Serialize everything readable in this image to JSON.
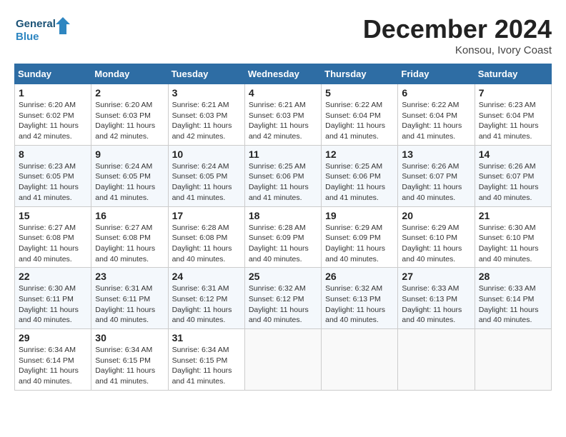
{
  "header": {
    "logo_line1": "General",
    "logo_line2": "Blue",
    "month": "December 2024",
    "location": "Konsou, Ivory Coast"
  },
  "days_of_week": [
    "Sunday",
    "Monday",
    "Tuesday",
    "Wednesday",
    "Thursday",
    "Friday",
    "Saturday"
  ],
  "weeks": [
    [
      {
        "day": "1",
        "info": "Sunrise: 6:20 AM\nSunset: 6:02 PM\nDaylight: 11 hours\nand 42 minutes."
      },
      {
        "day": "2",
        "info": "Sunrise: 6:20 AM\nSunset: 6:03 PM\nDaylight: 11 hours\nand 42 minutes."
      },
      {
        "day": "3",
        "info": "Sunrise: 6:21 AM\nSunset: 6:03 PM\nDaylight: 11 hours\nand 42 minutes."
      },
      {
        "day": "4",
        "info": "Sunrise: 6:21 AM\nSunset: 6:03 PM\nDaylight: 11 hours\nand 42 minutes."
      },
      {
        "day": "5",
        "info": "Sunrise: 6:22 AM\nSunset: 6:04 PM\nDaylight: 11 hours\nand 41 minutes."
      },
      {
        "day": "6",
        "info": "Sunrise: 6:22 AM\nSunset: 6:04 PM\nDaylight: 11 hours\nand 41 minutes."
      },
      {
        "day": "7",
        "info": "Sunrise: 6:23 AM\nSunset: 6:04 PM\nDaylight: 11 hours\nand 41 minutes."
      }
    ],
    [
      {
        "day": "8",
        "info": "Sunrise: 6:23 AM\nSunset: 6:05 PM\nDaylight: 11 hours\nand 41 minutes."
      },
      {
        "day": "9",
        "info": "Sunrise: 6:24 AM\nSunset: 6:05 PM\nDaylight: 11 hours\nand 41 minutes."
      },
      {
        "day": "10",
        "info": "Sunrise: 6:24 AM\nSunset: 6:05 PM\nDaylight: 11 hours\nand 41 minutes."
      },
      {
        "day": "11",
        "info": "Sunrise: 6:25 AM\nSunset: 6:06 PM\nDaylight: 11 hours\nand 41 minutes."
      },
      {
        "day": "12",
        "info": "Sunrise: 6:25 AM\nSunset: 6:06 PM\nDaylight: 11 hours\nand 41 minutes."
      },
      {
        "day": "13",
        "info": "Sunrise: 6:26 AM\nSunset: 6:07 PM\nDaylight: 11 hours\nand 40 minutes."
      },
      {
        "day": "14",
        "info": "Sunrise: 6:26 AM\nSunset: 6:07 PM\nDaylight: 11 hours\nand 40 minutes."
      }
    ],
    [
      {
        "day": "15",
        "info": "Sunrise: 6:27 AM\nSunset: 6:08 PM\nDaylight: 11 hours\nand 40 minutes."
      },
      {
        "day": "16",
        "info": "Sunrise: 6:27 AM\nSunset: 6:08 PM\nDaylight: 11 hours\nand 40 minutes."
      },
      {
        "day": "17",
        "info": "Sunrise: 6:28 AM\nSunset: 6:08 PM\nDaylight: 11 hours\nand 40 minutes."
      },
      {
        "day": "18",
        "info": "Sunrise: 6:28 AM\nSunset: 6:09 PM\nDaylight: 11 hours\nand 40 minutes."
      },
      {
        "day": "19",
        "info": "Sunrise: 6:29 AM\nSunset: 6:09 PM\nDaylight: 11 hours\nand 40 minutes."
      },
      {
        "day": "20",
        "info": "Sunrise: 6:29 AM\nSunset: 6:10 PM\nDaylight: 11 hours\nand 40 minutes."
      },
      {
        "day": "21",
        "info": "Sunrise: 6:30 AM\nSunset: 6:10 PM\nDaylight: 11 hours\nand 40 minutes."
      }
    ],
    [
      {
        "day": "22",
        "info": "Sunrise: 6:30 AM\nSunset: 6:11 PM\nDaylight: 11 hours\nand 40 minutes."
      },
      {
        "day": "23",
        "info": "Sunrise: 6:31 AM\nSunset: 6:11 PM\nDaylight: 11 hours\nand 40 minutes."
      },
      {
        "day": "24",
        "info": "Sunrise: 6:31 AM\nSunset: 6:12 PM\nDaylight: 11 hours\nand 40 minutes."
      },
      {
        "day": "25",
        "info": "Sunrise: 6:32 AM\nSunset: 6:12 PM\nDaylight: 11 hours\nand 40 minutes."
      },
      {
        "day": "26",
        "info": "Sunrise: 6:32 AM\nSunset: 6:13 PM\nDaylight: 11 hours\nand 40 minutes."
      },
      {
        "day": "27",
        "info": "Sunrise: 6:33 AM\nSunset: 6:13 PM\nDaylight: 11 hours\nand 40 minutes."
      },
      {
        "day": "28",
        "info": "Sunrise: 6:33 AM\nSunset: 6:14 PM\nDaylight: 11 hours\nand 40 minutes."
      }
    ],
    [
      {
        "day": "29",
        "info": "Sunrise: 6:34 AM\nSunset: 6:14 PM\nDaylight: 11 hours\nand 40 minutes."
      },
      {
        "day": "30",
        "info": "Sunrise: 6:34 AM\nSunset: 6:15 PM\nDaylight: 11 hours\nand 41 minutes."
      },
      {
        "day": "31",
        "info": "Sunrise: 6:34 AM\nSunset: 6:15 PM\nDaylight: 11 hours\nand 41 minutes."
      },
      null,
      null,
      null,
      null
    ]
  ]
}
